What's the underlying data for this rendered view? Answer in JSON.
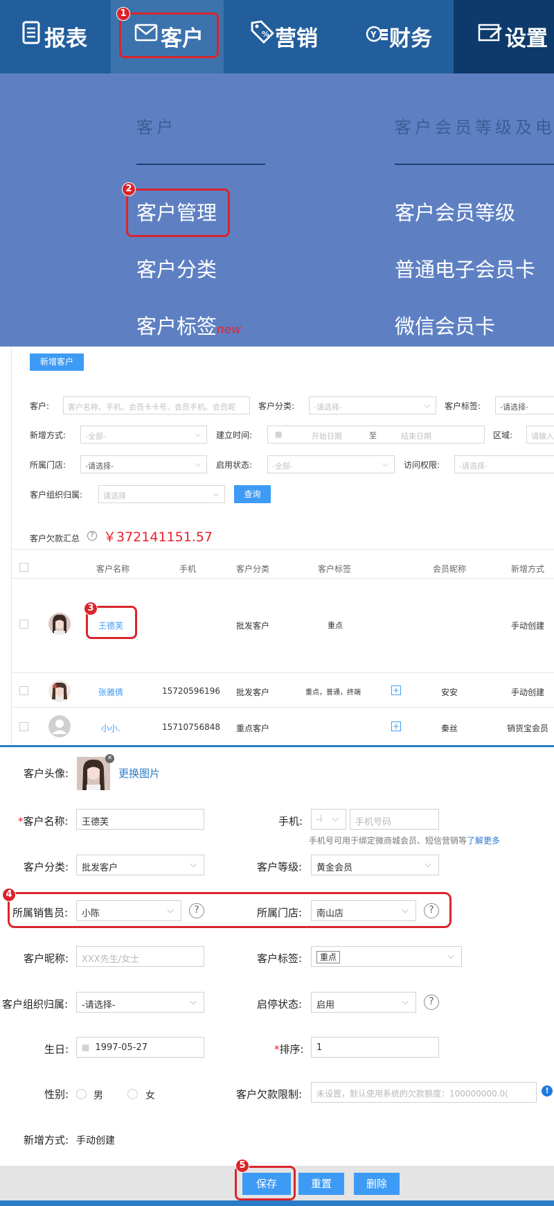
{
  "nav": {
    "items": [
      {
        "label": "报表",
        "icon": "report-icon"
      },
      {
        "label": "客户",
        "icon": "mail-icon"
      },
      {
        "label": "营销",
        "icon": "tag-icon"
      },
      {
        "label": "财务",
        "icon": "finance-icon"
      },
      {
        "label": "设置",
        "icon": "settings-icon"
      }
    ]
  },
  "dropdown": {
    "col1_head": "客户",
    "col2_head": "客户会员等级及电",
    "col1_items": [
      "客户管理",
      "客户分类",
      "客户标签"
    ],
    "new_badge": "new",
    "col2_items": [
      "客户会员等级",
      "普通电子会员卡",
      "微信会员卡"
    ]
  },
  "steps": [
    "1",
    "2",
    "3",
    "4",
    "5"
  ],
  "list": {
    "add_button": "新增客户",
    "filters": {
      "customer_label": "客户:",
      "customer_placeholder": "客户名称、手机、会员卡卡号、会员手机、会员昵",
      "category_label": "客户分类:",
      "category_placeholder": "-请选择-",
      "tag_label": "客户标签:",
      "tag_placeholder": "-请选择-",
      "add_method_label": "新增方式:",
      "add_method_value": "-全部-",
      "created_label": "建立时间:",
      "start_date_placeholder": "开始日期",
      "to": "至",
      "end_date_placeholder": "结束日期",
      "region_label": "区域:",
      "region_placeholder": "请输入",
      "store_label": "所属门店:",
      "store_placeholder": "-请选择-",
      "status_label": "启用状态:",
      "status_value": "-全部-",
      "access_label": "访问权限:",
      "access_placeholder": "-请选择-",
      "org_label": "客户组织归属:",
      "org_placeholder": "请选择",
      "query_button": "查询"
    },
    "debt_label": "客户欠款汇总",
    "debt_value": "￥372141151.57",
    "columns": [
      "客户名称",
      "手机",
      "客户分类",
      "客户标签",
      "会员昵称",
      "新增方式"
    ],
    "rows": [
      {
        "name": "王德芙",
        "phone": "",
        "category": "批发客户",
        "tags": "重点",
        "nickname": "",
        "method": "手动创建"
      },
      {
        "name": "张雅倩",
        "phone": "15720596196",
        "category": "批发客户",
        "tags": "重点，普通，终端",
        "nickname": "安安",
        "method": "手动创建"
      },
      {
        "name": "小小.",
        "phone": "15710756848",
        "category": "重点客户",
        "tags": "",
        "nickname": "秦丝",
        "method": "销货宝会员"
      }
    ]
  },
  "form": {
    "avatar_label": "客户头像:",
    "change_image": "更换图片",
    "name_label": "客户名称:",
    "name_value": "王德芙",
    "phone_label": "手机:",
    "phone_prefix": "-i",
    "phone_placeholder": "手机号码",
    "phone_hint": "手机号可用于绑定微商城会员、短信营销等",
    "learn_more": "了解更多",
    "category_label": "客户分类:",
    "category_value": "批发客户",
    "level_label": "客户等级:",
    "level_value": "黄金会员",
    "sales_label": "所属销售员:",
    "sales_value": "小陈",
    "store_label": "所属门店:",
    "store_value": "南山店",
    "nickname_label": "客户昵称:",
    "nickname_placeholder": "XXX先生/女士",
    "tag_label": "客户标签:",
    "tag_value": "重点",
    "org_label": "客户组织归属:",
    "org_value": "-请选择-",
    "status_label": "启停状态:",
    "status_value": "启用",
    "birthday_label": "生日:",
    "birthday_value": "1997-05-27",
    "sort_label": "排序:",
    "sort_value": "1",
    "gender_label": "性别:",
    "male": "男",
    "female": "女",
    "debt_limit_label": "客户欠款限制:",
    "debt_limit_placeholder": "未设置，默认使用系统的欠款额度：100000000.0(",
    "add_method_label": "新增方式:",
    "add_method_value": "手动创建",
    "save": "保存",
    "reset": "重置",
    "delete": "删除"
  },
  "colors": {
    "nav_bg": "#235e9c",
    "dropdown_bg": "#5e80c3",
    "accent": "#3d9bf5",
    "highlight": "#d9252b",
    "debt": "#e8202a"
  }
}
